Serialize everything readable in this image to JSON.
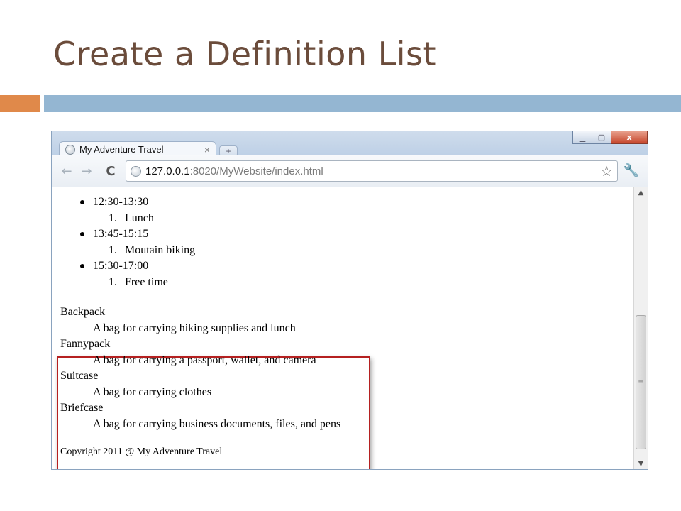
{
  "slide": {
    "title": "Create a Definition List"
  },
  "browser": {
    "tab_title": "My Adventure Travel",
    "tab_close": "×",
    "new_tab": "+",
    "url_host": "127.0.0.1",
    "url_path": ":8020/MyWebsite/index.html",
    "icons": {
      "back": "←",
      "forward": "→",
      "reload": "C",
      "star": "☆",
      "wrench": "🔧",
      "minimize": "▁",
      "maximize": "▢",
      "close": "x",
      "scroll_up": "▲",
      "scroll_down": "▼",
      "thumb_grip": "≡"
    }
  },
  "page": {
    "schedule": [
      {
        "time": "12:30-13:30",
        "activity_num": "1.",
        "activity": "Lunch"
      },
      {
        "time": "13:45-15:15",
        "activity_num": "1.",
        "activity": "Moutain biking"
      },
      {
        "time": "15:30-17:00",
        "activity_num": "1.",
        "activity": "Free time"
      }
    ],
    "definitions": [
      {
        "term": "Backpack",
        "desc": "A bag for carrying hiking supplies and lunch"
      },
      {
        "term": "Fannypack",
        "desc": "A bag for carrying a passport, wallet, and camera"
      },
      {
        "term": "Suitcase",
        "desc": "A bag for carrying clothes"
      },
      {
        "term": "Briefcase",
        "desc": "A bag for carrying business documents, files, and pens"
      }
    ],
    "copyright": "Copyright 2011 @ My Adventure Travel"
  },
  "colors": {
    "title": "#6b4c3b",
    "accent_orange": "#e0894a",
    "accent_blue": "#94b6d2",
    "highlight_box": "#b52020"
  }
}
